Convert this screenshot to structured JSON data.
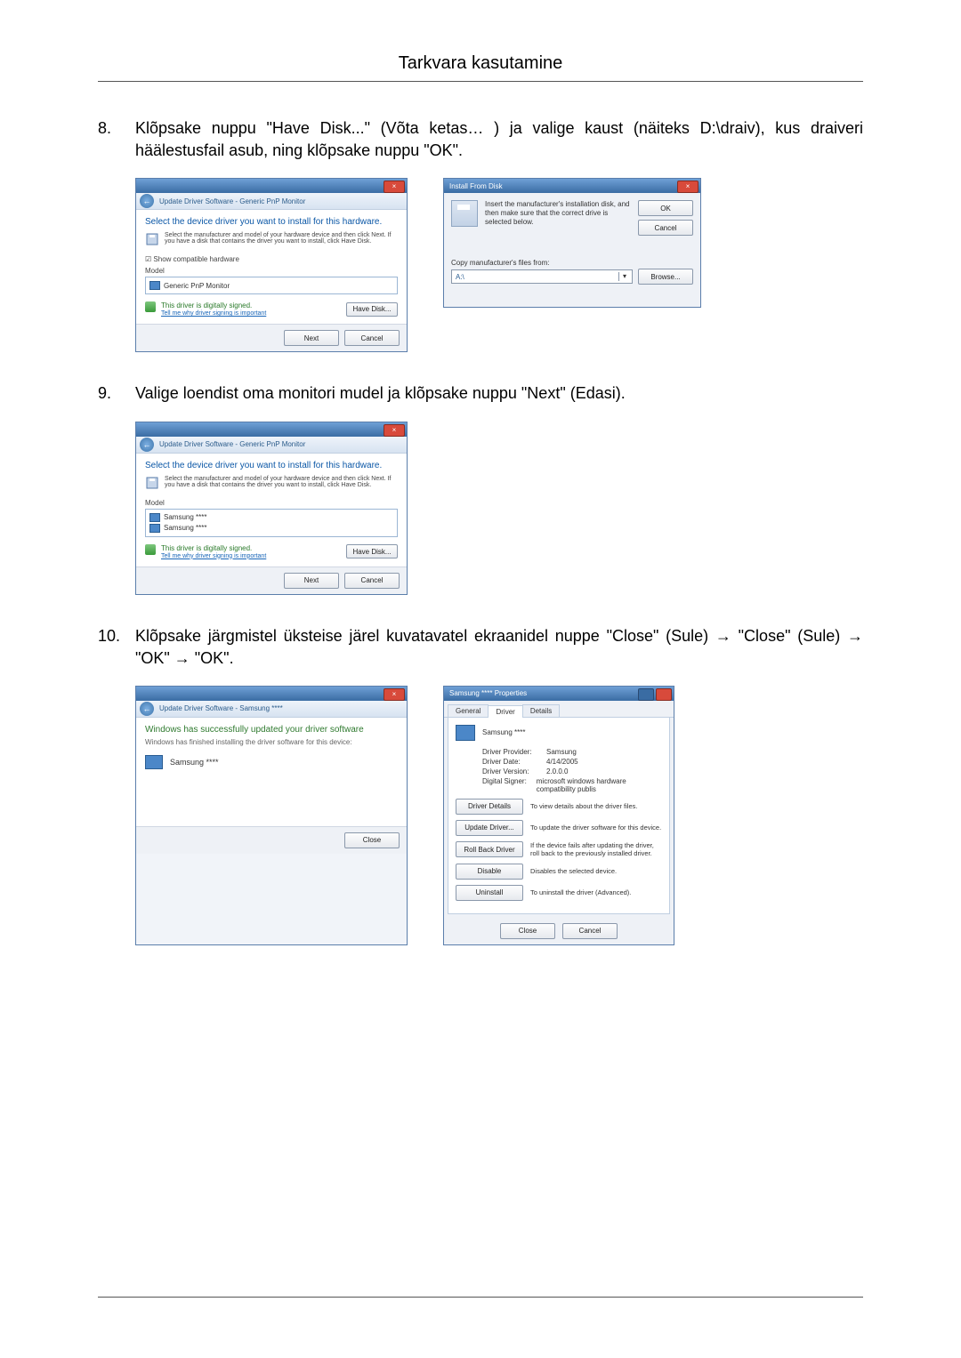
{
  "page": {
    "title": "Tarkvara kasutamine"
  },
  "step8": {
    "num": "8.",
    "text": "Klõpsake nuppu \"Have Disk...\" (Võta ketas… ) ja valige kaust (näiteks D:\\draiv), kus draiveri häälestusfail asub, ning klõpsake nuppu \"OK\"."
  },
  "fig8a": {
    "breadcrumb": "Update Driver Software - Generic PnP Monitor",
    "bluehead": "Select the device driver you want to install for this hardware.",
    "instr": "Select the manufacturer and model of your hardware device and then click Next. If you have a disk that contains the driver you want to install, click Have Disk.",
    "chk": "Show compatible hardware",
    "listlabel": "Model",
    "item": "Generic PnP Monitor",
    "signed": "This driver is digitally signed.",
    "why": "Tell me why driver signing is important",
    "havedisk": "Have Disk...",
    "next": "Next",
    "cancel": "Cancel"
  },
  "fig8b": {
    "title": "Install From Disk",
    "msg": "Insert the manufacturer's installation disk, and then make sure that the correct drive is selected below.",
    "ok": "OK",
    "cancel": "Cancel",
    "copylabel": "Copy manufacturer's files from:",
    "combo_value": "A:\\",
    "browse": "Browse..."
  },
  "step9": {
    "num": "9.",
    "text": "Valige loendist oma monitori mudel ja klõpsake nuppu \"Next\" (Edasi)."
  },
  "fig9": {
    "breadcrumb": "Update Driver Software - Generic PnP Monitor",
    "bluehead": "Select the device driver you want to install for this hardware.",
    "instr": "Select the manufacturer and model of your hardware device and then click Next. If you have a disk that contains the driver you want to install, click Have Disk.",
    "listlabel": "Model",
    "item1": "Samsung ****",
    "item2": "Samsung ****",
    "signed": "This driver is digitally signed.",
    "why": "Tell me why driver signing is important",
    "havedisk": "Have Disk...",
    "next": "Next",
    "cancel": "Cancel"
  },
  "step10": {
    "num": "10.",
    "text": "Klõpsake järgmistel üksteise järel kuvatavatel ekraanidel nuppe \"Close\" (Sule) → \"Close\" (Sule) → \"OK\" → \"OK\"."
  },
  "fig10a": {
    "breadcrumb": "Update Driver Software - Samsung ****",
    "greenhead": "Windows has successfully updated your driver software",
    "sub": "Windows has finished installing the driver software for this device:",
    "device": "Samsung ****",
    "close": "Close"
  },
  "fig10b": {
    "title": "Samsung **** Properties",
    "tabs": {
      "general": "General",
      "driver": "Driver",
      "details": "Details"
    },
    "device": "Samsung ****",
    "kv": {
      "provider_k": "Driver Provider:",
      "provider_v": "Samsung",
      "date_k": "Driver Date:",
      "date_v": "4/14/2005",
      "ver_k": "Driver Version:",
      "ver_v": "2.0.0.0",
      "sign_k": "Digital Signer:",
      "sign_v": "microsoft windows hardware compatibility publis"
    },
    "actions": {
      "details_btn": "Driver Details",
      "details_desc": "To view details about the driver files.",
      "update_btn": "Update Driver...",
      "update_desc": "To update the driver software for this device.",
      "rollback_btn": "Roll Back Driver",
      "rollback_desc": "If the device fails after updating the driver, roll back to the previously installed driver.",
      "disable_btn": "Disable",
      "disable_desc": "Disables the selected device.",
      "uninstall_btn": "Uninstall",
      "uninstall_desc": "To uninstall the driver (Advanced)."
    },
    "close": "Close",
    "cancel": "Cancel"
  }
}
